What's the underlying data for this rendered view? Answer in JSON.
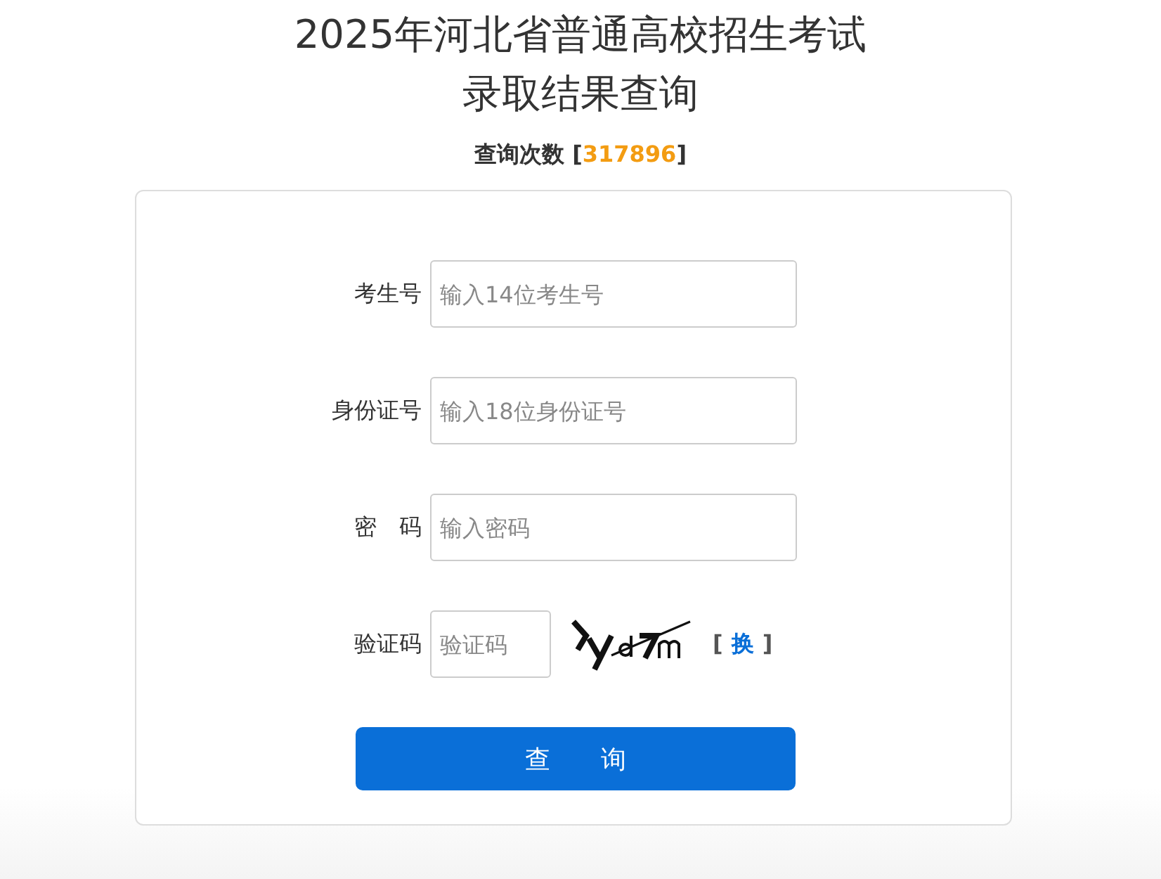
{
  "title_lines": [
    "2025年河北省普通高校招生考试",
    "录取结果查询"
  ],
  "query_count": {
    "label": "查询次数",
    "open": "[",
    "value": "317896",
    "close": "]"
  },
  "form": {
    "fields": [
      {
        "kind": "text",
        "label": "考生号",
        "placeholder": "输入14位考生号"
      },
      {
        "kind": "text",
        "label": "身份证号",
        "placeholder": "输入18位身份证号"
      },
      {
        "kind": "password",
        "label": "密　码",
        "placeholder": "输入密码"
      },
      {
        "kind": "captcha",
        "label": "验证码",
        "placeholder": "验证码",
        "refresh": {
          "open": "[",
          "link": "换",
          "close": "]"
        }
      }
    ],
    "submit": "查　　询"
  }
}
